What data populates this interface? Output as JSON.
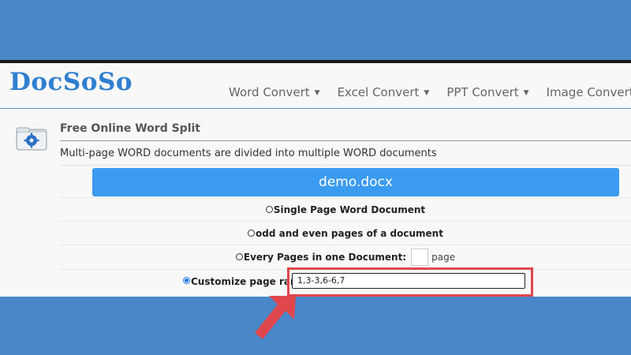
{
  "app": {
    "logo_text": "DocSoSo",
    "nav": [
      {
        "label": "Word Convert"
      },
      {
        "label": "Excel Convert"
      },
      {
        "label": "PPT Convert"
      },
      {
        "label": "Image Converter"
      }
    ]
  },
  "tool": {
    "title": "Free Online Word Split",
    "description": "Multi-page WORD documents are divided into multiple WORD documents",
    "file_name": "demo.docx",
    "options": [
      {
        "label": "Single Page Word Document",
        "checked": false
      },
      {
        "label": "odd and even pages of a document",
        "checked": false
      },
      {
        "label": "Every Pages in one Document:",
        "suffix": "page",
        "checked": false
      },
      {
        "label": "Customize page range",
        "checked": true
      }
    ],
    "page_range_value": "1,3-3,6-6,7"
  },
  "colors": {
    "background": "#4a87c9",
    "accent": "#3a9bf0",
    "highlight": "#e0474c"
  },
  "icons": {
    "caret": "caret-down-icon",
    "tool": "folder-gear-icon",
    "pointer": "red-arrow-icon"
  }
}
